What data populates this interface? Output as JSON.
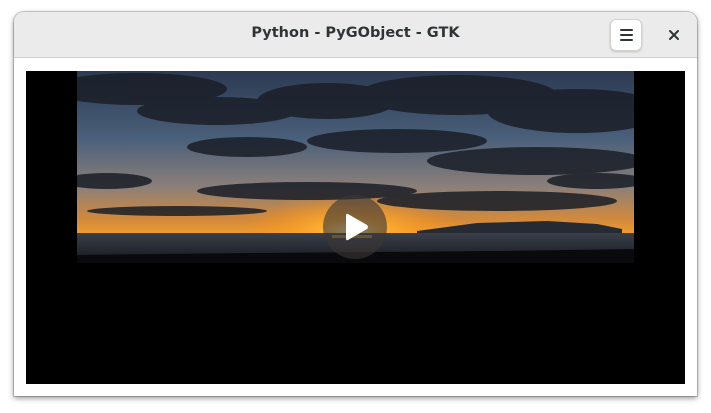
{
  "window": {
    "title": "Python - PyGObject - GTK"
  },
  "headerbar": {
    "menu_icon": "hamburger-menu-icon",
    "close_icon": "close-icon"
  },
  "video": {
    "state": "paused",
    "overlay_icon": "play-icon"
  }
}
